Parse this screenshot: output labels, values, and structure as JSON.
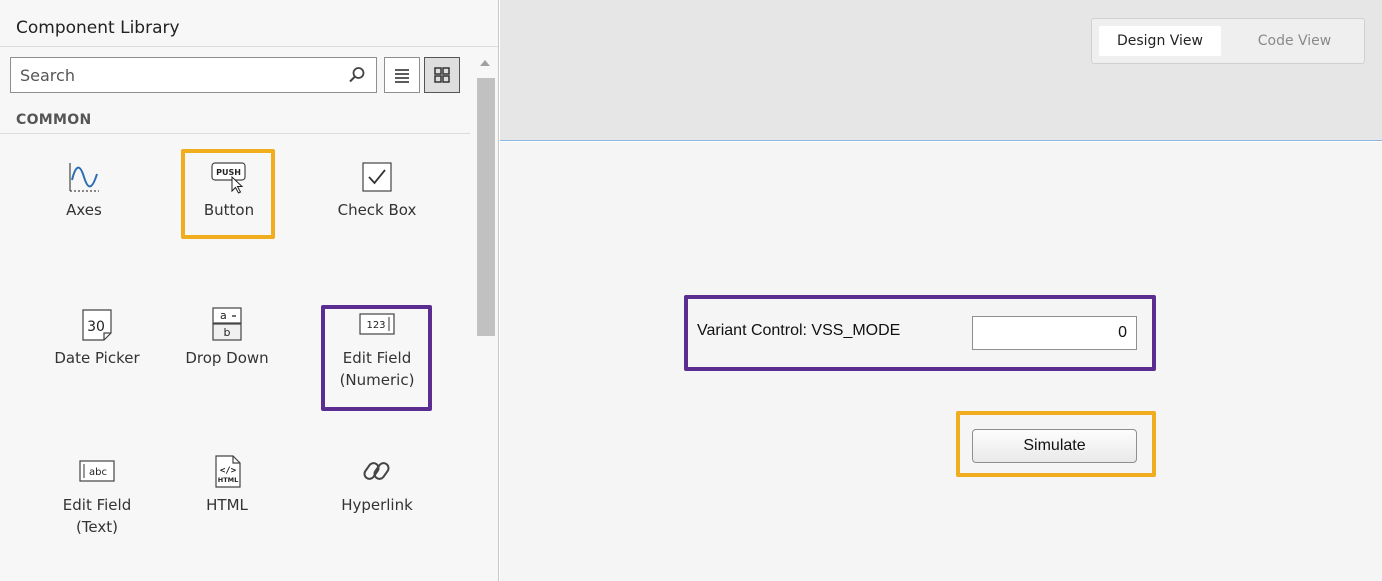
{
  "library": {
    "title": "Component Library",
    "search_placeholder": "Search",
    "section": "COMMON",
    "components": [
      {
        "label": "Axes",
        "label2": "",
        "icon": "axes-icon"
      },
      {
        "label": "Button",
        "label2": "",
        "icon": "push-button-icon"
      },
      {
        "label": "Check Box",
        "label2": "",
        "icon": "checkbox-icon"
      },
      {
        "label": "Date Picker",
        "label2": "",
        "icon": "date-picker-icon"
      },
      {
        "label": "Drop Down",
        "label2": "",
        "icon": "dropdown-icon"
      },
      {
        "label": "Edit Field",
        "label2": "(Numeric)",
        "icon": "numeric-field-icon"
      },
      {
        "label": "Edit Field",
        "label2": "(Text)",
        "icon": "text-field-icon"
      },
      {
        "label": "HTML",
        "label2": "",
        "icon": "html-icon"
      },
      {
        "label": "Hyperlink",
        "label2": "",
        "icon": "hyperlink-icon"
      }
    ],
    "icon_text": {
      "push": "PUSH",
      "date": "30",
      "dd_a": "a",
      "dd_b": "b",
      "num": "123",
      "abc": "abc",
      "html_tag": "</>",
      "html_word": "HTML"
    }
  },
  "view_toggle": {
    "design": "Design View",
    "code": "Code View",
    "active": "Design View"
  },
  "app": {
    "field_label": "Variant Control: VSS_MODE",
    "field_value": "0",
    "button_label": "Simulate"
  },
  "colors": {
    "highlight_orange": "#f0ad1e",
    "highlight_purple": "#5c2d91"
  }
}
